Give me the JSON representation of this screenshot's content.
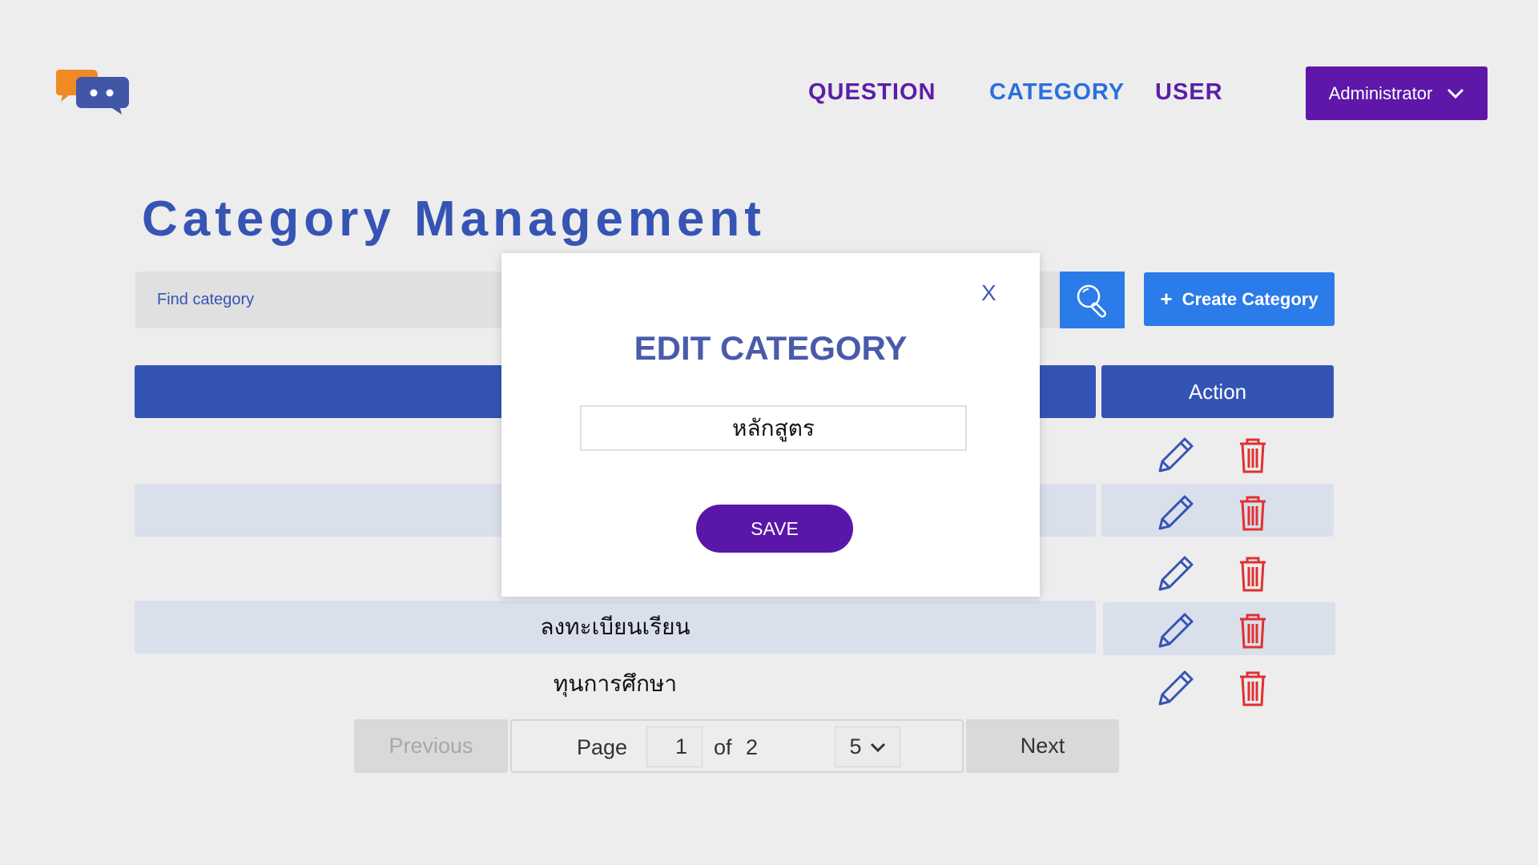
{
  "header": {
    "nav": [
      "QUESTION",
      "CATEGORY",
      "USER"
    ],
    "user_menu_label": "Administrator"
  },
  "page": {
    "title": "Category Management",
    "search_placeholder": "Find category",
    "create_label": "Create Category"
  },
  "table": {
    "action_header": "Action",
    "visible_rows": [
      "ลงทะเบียนเรียน",
      "ทุนการศึกษา"
    ]
  },
  "pagination": {
    "previous_label": "Previous",
    "page_label": "Page",
    "current_page": "1",
    "of_label": "of",
    "total_pages": "2",
    "page_size": "5",
    "next_label": "Next"
  },
  "modal": {
    "close_label": "X",
    "title": "EDIT CATEGORY",
    "input_value": "หลักสูตร",
    "save_label": "SAVE"
  },
  "colors": {
    "primary_blue": "#3454b5",
    "accent_blue": "#2b7be9",
    "purple": "#5e17a8",
    "delete_red": "#e03131"
  }
}
